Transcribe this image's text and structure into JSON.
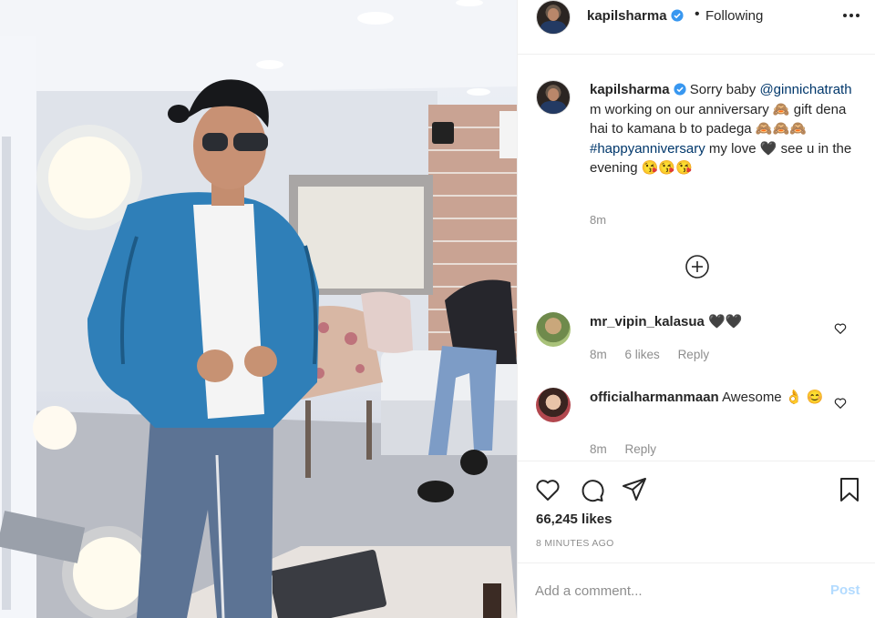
{
  "colors": {
    "link": "#00376b",
    "verified": "#3897f0",
    "muted": "#8e8e8e",
    "post_disabled": "#b3dbff"
  },
  "header": {
    "username": "kapilsharma",
    "separator": "•",
    "follow_status": "Following",
    "more_icon": "more-dots-icon"
  },
  "caption": {
    "username": "kapilsharma",
    "text_1": "Sorry baby",
    "mention": "@ginnichatrath",
    "text_2": "m working on our anniversary 🙈 gift dena hai to kamana b to padega 🙈🙈🙈",
    "hashtag": "#happyanniversary",
    "text_3": "my love 🖤 see u in the evening 😘😘😘",
    "time": "8m"
  },
  "load_more_icon": "plus-circle-icon",
  "comments": [
    {
      "username": "mr_vipin_kalasua",
      "text": "🖤🖤",
      "time": "8m",
      "likes": "6 likes",
      "reply": "Reply"
    },
    {
      "username": "officialharmanmaan",
      "text": "Awesome 👌 😊",
      "time": "8m",
      "reply": "Reply"
    }
  ],
  "actions": {
    "like_icon": "heart-icon",
    "comment_icon": "comment-bubble-icon",
    "share_icon": "paper-plane-icon",
    "save_icon": "bookmark-icon",
    "likes": "66,245 likes",
    "timestamp": "8 MINUTES AGO"
  },
  "add_comment": {
    "placeholder": "Add a comment...",
    "post_label": "Post"
  }
}
